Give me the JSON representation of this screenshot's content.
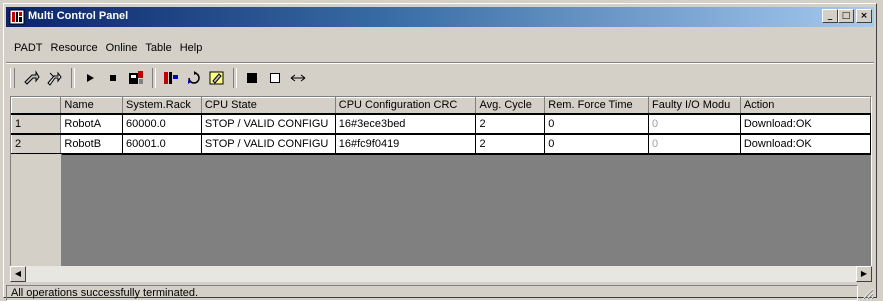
{
  "window": {
    "title": "Multi Control Panel",
    "controls": {
      "minimize": "_",
      "maximize": "□",
      "close": "×"
    }
  },
  "menu": [
    "PADT",
    "Resource",
    "Online",
    "Table",
    "Help"
  ],
  "toolbar": {
    "icons": [
      "connect-icon",
      "disconnect-icon",
      "run-icon",
      "stop-icon",
      "download-icon",
      "resource-icon",
      "refresh-icon",
      "edit-icon",
      "select-all-icon",
      "deselect-icon",
      "exchange-icon"
    ]
  },
  "table": {
    "columns": [
      "",
      "Name",
      "System.Rack",
      "CPU State",
      "CPU Configuration CRC",
      "Avg. Cycle",
      "Rem. Force Time",
      "Faulty I/O Modu",
      "Action"
    ],
    "rows": [
      {
        "id": "1",
        "name": "RobotA",
        "rack": "60000.0",
        "cpu_state": "STOP / VALID CONFIGU",
        "crc": "16#3ece3bed",
        "avg_cycle": "2",
        "force_time": "0",
        "faulty": "0",
        "action": "Download:OK"
      },
      {
        "id": "2",
        "name": "RobotB",
        "rack": "60001.0",
        "cpu_state": "STOP / VALID CONFIGU",
        "crc": "16#fc9f0419",
        "avg_cycle": "2",
        "force_time": "0",
        "faulty": "0",
        "action": "Download:OK"
      }
    ]
  },
  "scrollbar": {
    "left_arrow": "◀",
    "right_arrow": "▶"
  },
  "status": {
    "text": "All operations successfully terminated."
  },
  "colors": {
    "title_start": "#0a246a",
    "title_end": "#a6caf0",
    "face": "#d4d0c8",
    "grid_bg": "#808080"
  }
}
